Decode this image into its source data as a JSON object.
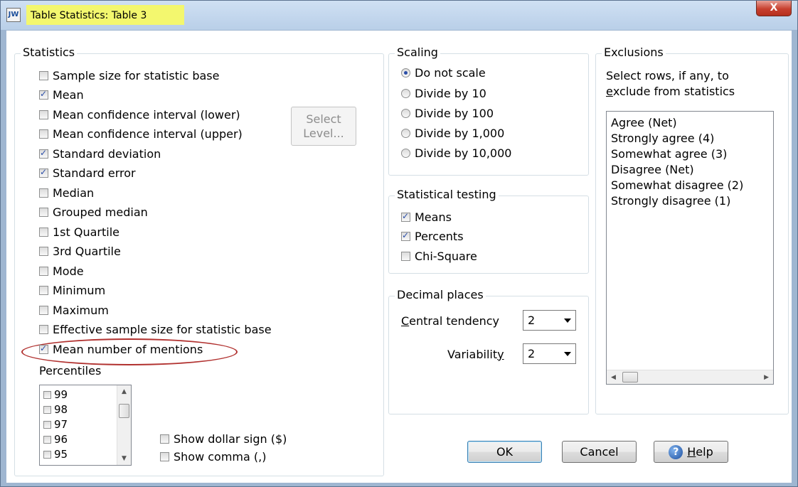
{
  "window": {
    "title": "Table Statistics: Table 3",
    "app_icon_text": "JW",
    "close_label": "X"
  },
  "statistics": {
    "title": "Statistics",
    "items": [
      {
        "label": "Sample size for statistic base",
        "checked": false
      },
      {
        "label": "Mean",
        "checked": true
      },
      {
        "label": "Mean confidence interval (lower)",
        "checked": false
      },
      {
        "label": "Mean confidence interval (upper)",
        "checked": false
      },
      {
        "label": "Standard deviation",
        "checked": true
      },
      {
        "label": "Standard error",
        "checked": true
      },
      {
        "label": "Median",
        "checked": false
      },
      {
        "label": "Grouped median",
        "checked": false
      },
      {
        "label": "1st Quartile",
        "checked": false
      },
      {
        "label": "3rd Quartile",
        "checked": false
      },
      {
        "label": "Mode",
        "checked": false
      },
      {
        "label": "Minimum",
        "checked": false
      },
      {
        "label": "Maximum",
        "checked": false
      },
      {
        "label": "Effective sample size for statistic base",
        "checked": false
      },
      {
        "label": "Mean number of mentions",
        "checked": true
      }
    ],
    "select_level_line1": "Select",
    "select_level_line2": "Level...",
    "percentiles_label": "Percentiles",
    "percentiles": [
      "99",
      "98",
      "97",
      "96",
      "95"
    ],
    "show_dollar": "Show dollar sign ($)",
    "show_comma": "Show comma (,)"
  },
  "scaling": {
    "title": "Scaling",
    "options": [
      {
        "label": "Do not scale",
        "selected": true
      },
      {
        "label": "Divide by 10",
        "selected": false
      },
      {
        "label": "Divide by 100",
        "selected": false
      },
      {
        "label": "Divide by 1,000",
        "selected": false
      },
      {
        "label": "Divide by 10,000",
        "selected": false
      }
    ]
  },
  "testing": {
    "title": "Statistical testing",
    "items": [
      {
        "label": "Means",
        "checked": true
      },
      {
        "label": "Percents",
        "checked": true
      },
      {
        "label": "Chi-Square",
        "checked": false
      }
    ]
  },
  "decimals": {
    "title": "Decimal places",
    "central_tendency_label_first": "C",
    "central_tendency_label_rest": "entral tendency",
    "central_tendency_value": "2",
    "variability_label_main": "Variabilit",
    "variability_label_underlined": "y",
    "variability_value": "2"
  },
  "exclusions": {
    "title": "Exclusions",
    "description_line1": "Select rows, if any, to",
    "description_line2_first": "e",
    "description_line2_rest": "xclude from statistics",
    "items": [
      "Agree (Net)",
      "Strongly agree (4)",
      "Somewhat agree (3)",
      "Disagree (Net)",
      "Somewhat disagree (2)",
      "Strongly disagree (1)"
    ]
  },
  "buttons": {
    "ok": "OK",
    "cancel": "Cancel",
    "help_first": "H",
    "help_rest": "elp",
    "help_icon_glyph": "?"
  },
  "colors": {
    "title_highlight": "#f3f76e",
    "annotation_ellipse": "#b1312f",
    "check_mark": "#2b4ea8"
  }
}
